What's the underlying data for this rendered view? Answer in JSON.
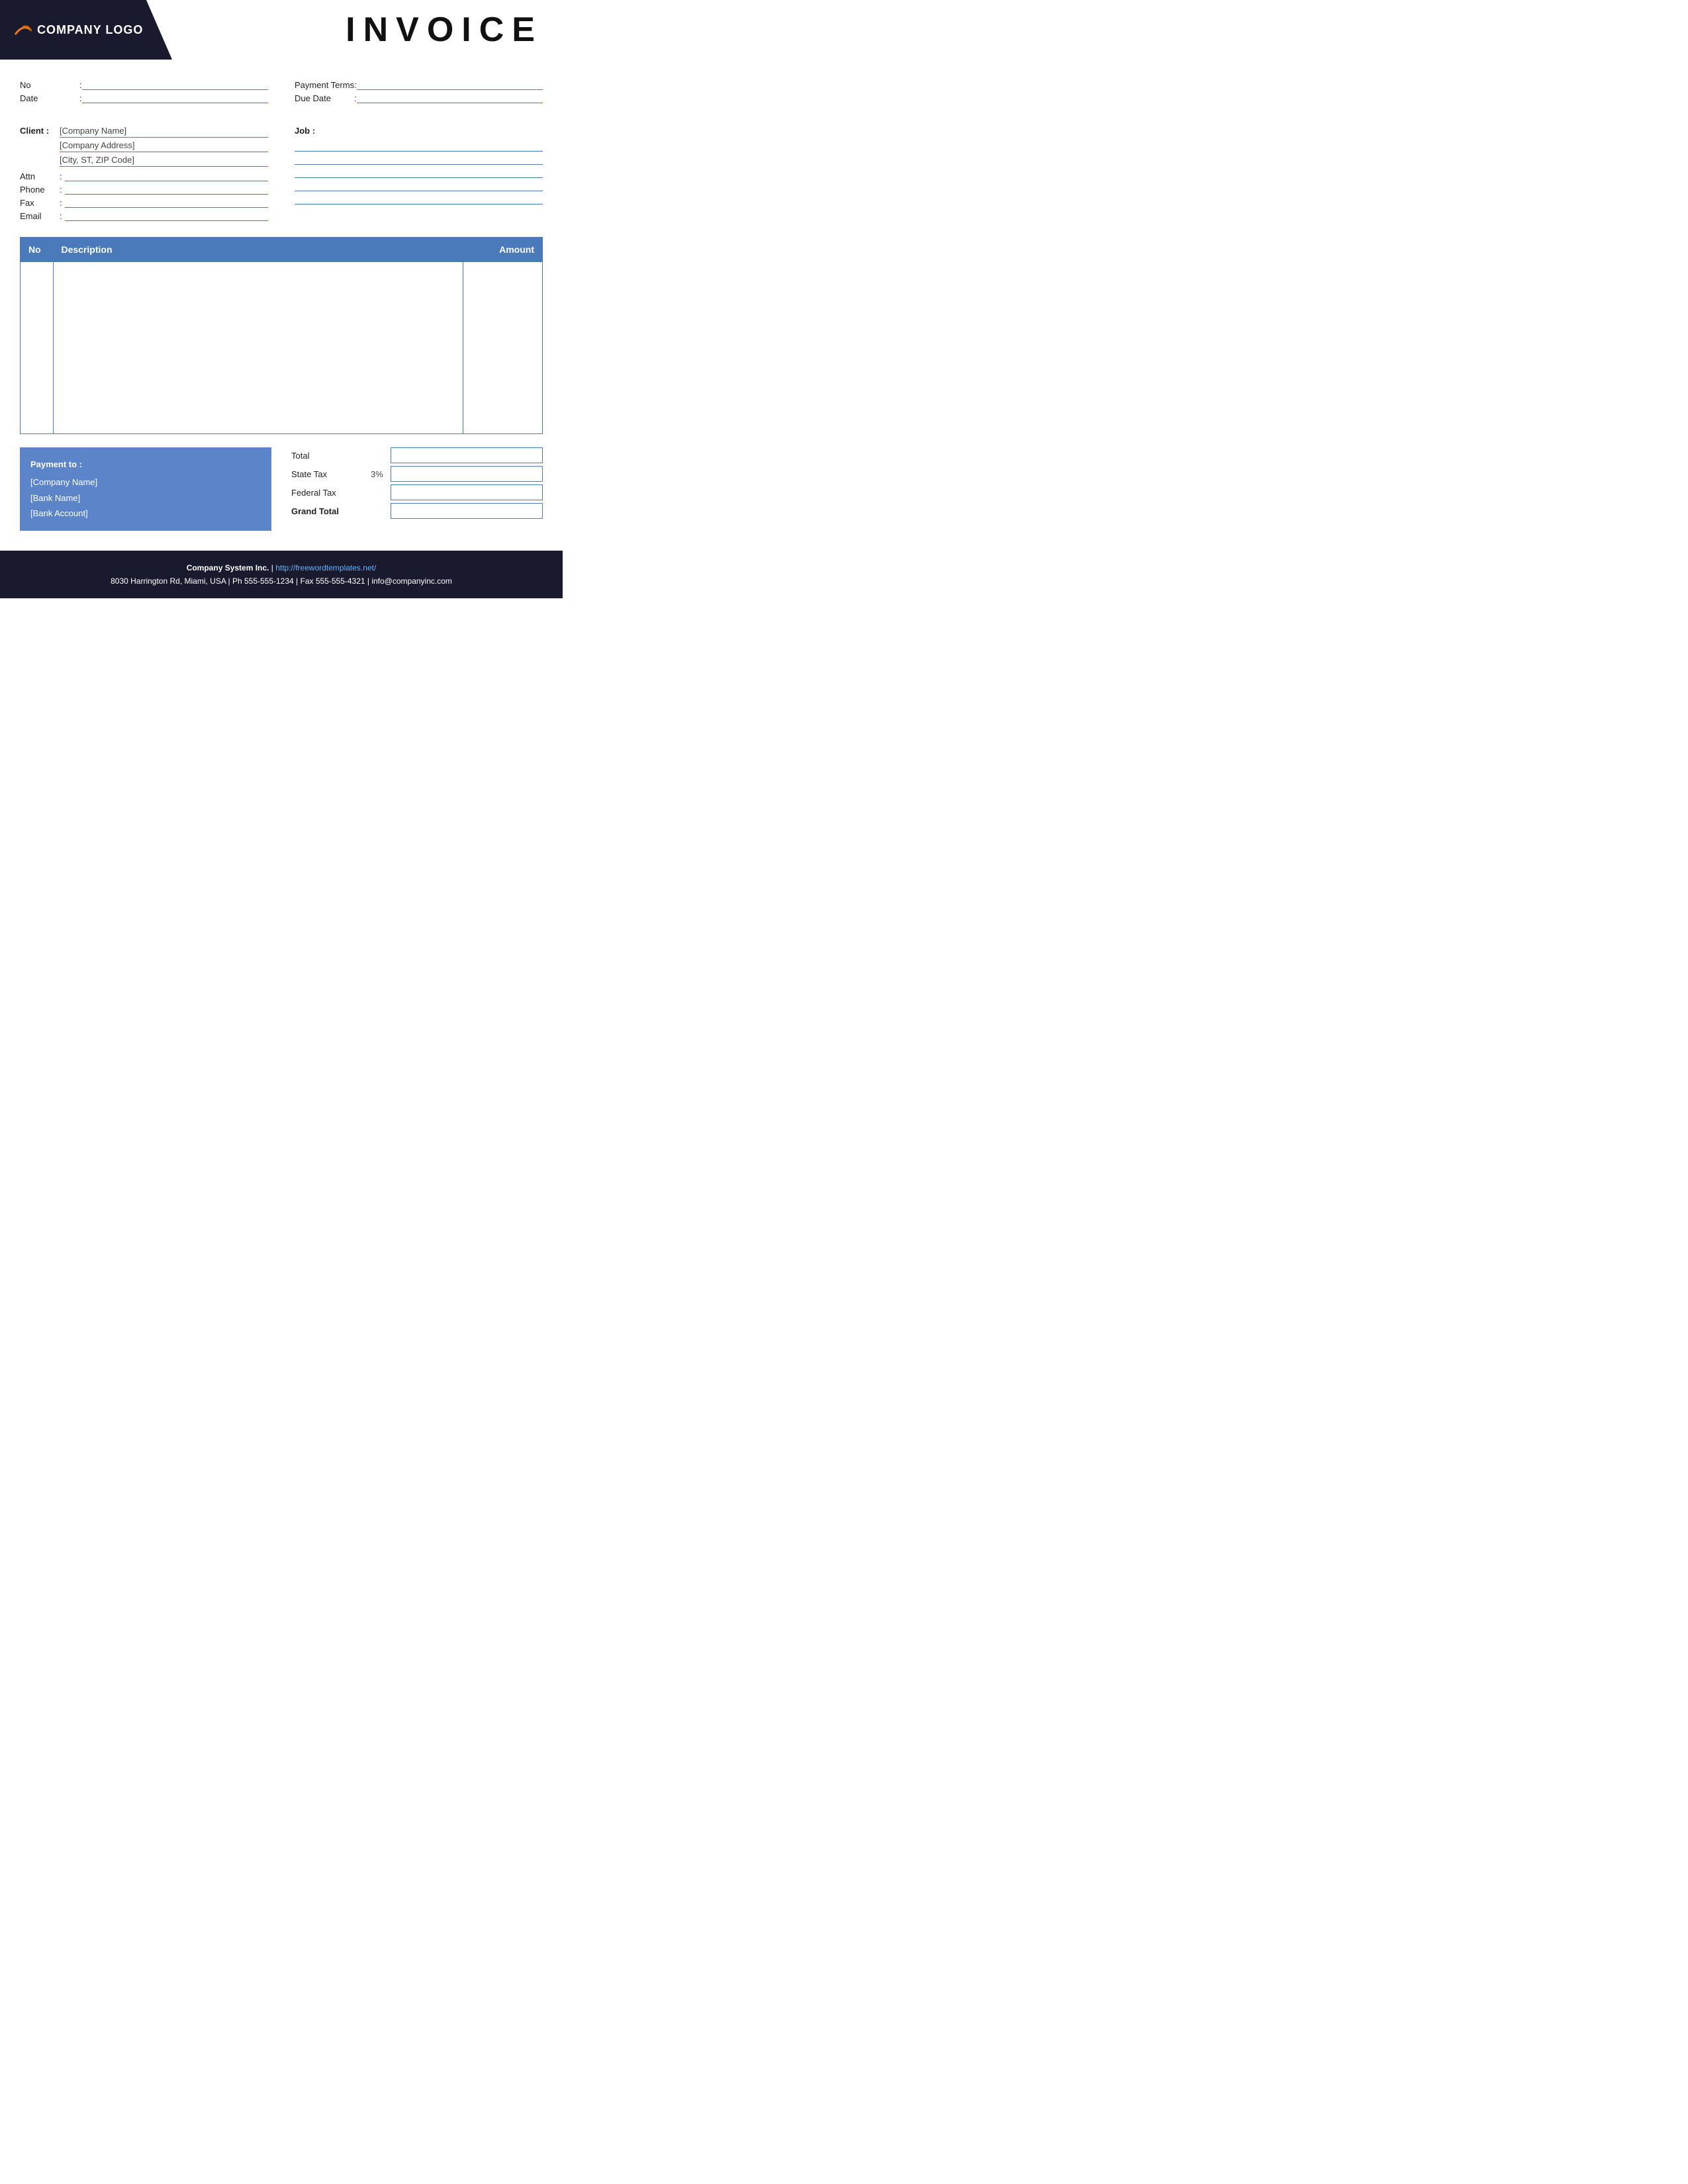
{
  "header": {
    "logo_text": "COMPANY LOGO",
    "title": "INVOICE"
  },
  "info": {
    "no_label": "No",
    "no_colon": ":",
    "date_label": "Date",
    "date_colon": ":",
    "payment_terms_label": "Payment  Terms",
    "payment_terms_colon": ":",
    "due_date_label": "Due Date",
    "due_date_colon": ":"
  },
  "client": {
    "label": "Client :",
    "company_name": "[Company Name]",
    "company_address": "[Company Address]",
    "city_zip": "[City, ST, ZIP Code]",
    "attn_label": "Attn",
    "attn_colon": ":",
    "phone_label": "Phone",
    "phone_colon": ":",
    "fax_label": "Fax",
    "fax_colon": ":",
    "email_label": "Email",
    "email_colon": ":"
  },
  "job": {
    "label": "Job :"
  },
  "table": {
    "col_no": "No",
    "col_description": "Description",
    "col_amount": "Amount"
  },
  "payment": {
    "title": "Payment to :",
    "company_name": "[Company Name]",
    "bank_name": "[Bank Name]",
    "bank_account": "[Bank Account]"
  },
  "totals": {
    "total_label": "Total",
    "state_tax_label": "State Tax",
    "state_tax_pct": "3%",
    "federal_tax_label": "Federal Tax",
    "grand_total_label": "Grand Total"
  },
  "footer": {
    "company": "Company System Inc.",
    "separator": " | ",
    "website": "http://freewordtemplates.net/",
    "address": "8030 Harrington Rd, Miami, USA | Ph 555-555-1234 | Fax 555-555-4321 | info@companyinc.com"
  }
}
